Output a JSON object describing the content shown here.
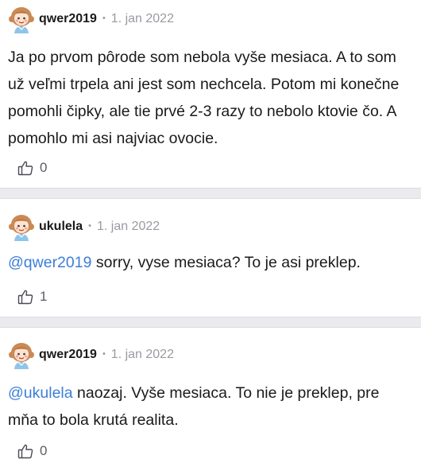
{
  "comments": [
    {
      "author": "qwer2019",
      "separator": "•",
      "date": "1. jan 2022",
      "mention": "",
      "text": "Ja po prvom pôrode som nebola vyše mesiaca. A to som už veľmi trpela ani jest som nechcela. Potom mi konečne pomohli čipky, ale tie prvé 2-3 razy to nebolo ktovie čo. A pomohlo mi asi najviac ovocie.",
      "likes": "0"
    },
    {
      "author": "ukulela",
      "separator": "•",
      "date": "1. jan 2022",
      "mention": "@qwer2019",
      "text": " sorry, vyse mesiaca? To je asi preklep.",
      "likes": "1"
    },
    {
      "author": "qwer2019",
      "separator": "•",
      "date": "1. jan 2022",
      "mention": "@ukulela",
      "text": " naozaj. Vyše mesiaca. To nie je preklep, pre mňa to bola krutá realita.",
      "likes": "0"
    }
  ],
  "icons": {
    "avatar": "cartoon-girl-avatar-icon",
    "like": "thumbs-up-icon"
  },
  "colors": {
    "mention": "#3b7fd8",
    "divider": "#ebebef",
    "meta": "#9a9aa3"
  }
}
